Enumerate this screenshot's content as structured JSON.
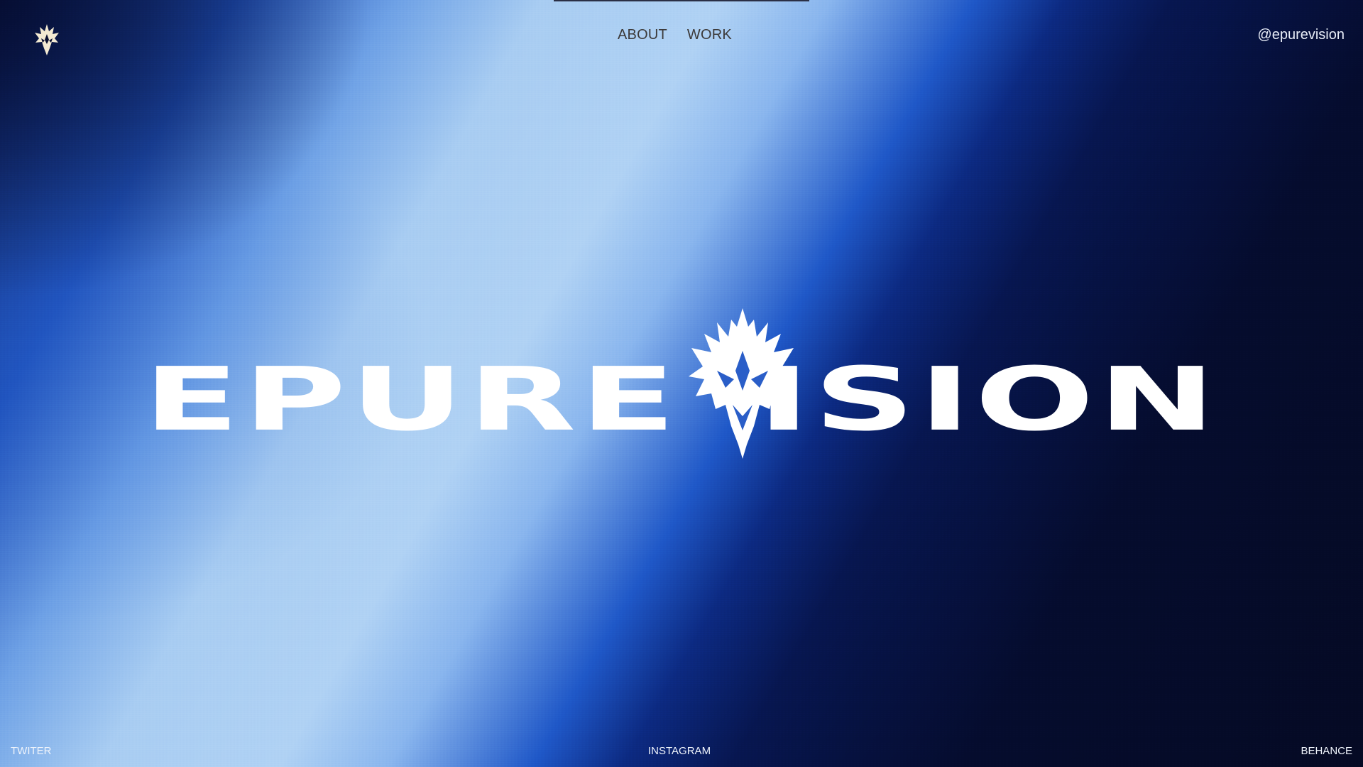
{
  "brand": {
    "wordmark_left": "EPURE",
    "wordmark_right": "ISION",
    "logo_icon": "emblem-icon"
  },
  "nav": {
    "items": [
      {
        "label": "ABOUT"
      },
      {
        "label": "WORK"
      }
    ]
  },
  "header": {
    "handle": "@epurevision"
  },
  "footer": {
    "twitter": "TWITER",
    "instagram": "INSTAGRAM",
    "behance": "BEHANCE"
  },
  "colors": {
    "dark_navy": "#050a24",
    "royal_blue": "#1f58c8",
    "light_blue": "#b0d2f4",
    "white": "#ffffff",
    "nav_text": "#3c3a3a",
    "emblem_small": "#f3ead2"
  }
}
